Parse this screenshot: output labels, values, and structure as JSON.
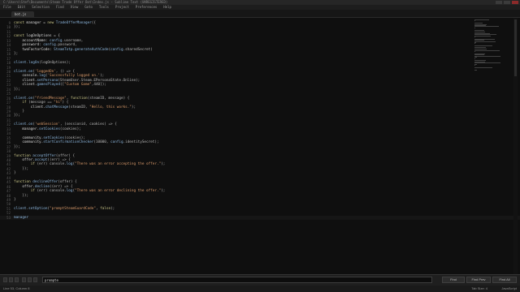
{
  "window": {
    "title": "C:\\Users\\Stef\\Documents\\Steam Trade Offer Bot\\Index.js - Sublime Text (UNREGISTERED)"
  },
  "menu": [
    "File",
    "Edit",
    "Selection",
    "Find",
    "View",
    "Goto",
    "Tools",
    "Project",
    "Preferences",
    "Help"
  ],
  "tabs": [
    {
      "label": "bot.js"
    }
  ],
  "editor": {
    "lines": [
      {
        "n": "9",
        "tokens": [
          [
            "k",
            "const "
          ],
          [
            "v",
            "manager = "
          ],
          [
            "k",
            "new "
          ],
          [
            "fn",
            "TradeOfferManager"
          ],
          [
            "p",
            "({"
          ]
        ]
      },
      {
        "n": "10",
        "tokens": [
          [
            "p",
            "});"
          ]
        ]
      },
      {
        "n": "11",
        "tokens": []
      },
      {
        "n": "12",
        "tokens": [
          [
            "k",
            "const "
          ],
          [
            "v",
            "logOnOptions = {"
          ]
        ]
      },
      {
        "n": "13",
        "tokens": [
          [
            "v",
            "    accountName: "
          ],
          [
            "fn",
            "config"
          ],
          [
            "p",
            ".username,"
          ]
        ]
      },
      {
        "n": "14",
        "tokens": [
          [
            "v",
            "    password: "
          ],
          [
            "fn",
            "config"
          ],
          [
            "p",
            ".password,"
          ]
        ]
      },
      {
        "n": "15",
        "tokens": [
          [
            "v",
            "    twoFactorCode: "
          ],
          [
            "fn",
            "SteamTotp"
          ],
          [
            "p",
            "."
          ],
          [
            "fn",
            "generateAuthCode"
          ],
          [
            "p",
            "("
          ],
          [
            "fn",
            "config"
          ],
          [
            "p",
            ".sharedSecret)"
          ]
        ]
      },
      {
        "n": "16",
        "tokens": [
          [
            "p",
            "};"
          ]
        ]
      },
      {
        "n": "17",
        "tokens": []
      },
      {
        "n": "18",
        "tokens": [
          [
            "fn",
            "client"
          ],
          [
            "p",
            "."
          ],
          [
            "fn",
            "logOn"
          ],
          [
            "p",
            "(logOnOptions);"
          ]
        ]
      },
      {
        "n": "19",
        "tokens": []
      },
      {
        "n": "20",
        "tokens": [
          [
            "fn",
            "client"
          ],
          [
            "p",
            "."
          ],
          [
            "fn",
            "on"
          ],
          [
            "p",
            "("
          ],
          [
            "s",
            "'loggedOn'"
          ],
          [
            "p",
            ", () => {"
          ]
        ]
      },
      {
        "n": "21",
        "tokens": [
          [
            "v",
            "    console."
          ],
          [
            "fn",
            "log"
          ],
          [
            "p",
            "("
          ],
          [
            "s",
            "'Successfully logged on.'"
          ],
          [
            "p",
            ");"
          ]
        ]
      },
      {
        "n": "22",
        "tokens": [
          [
            "v",
            "    client."
          ],
          [
            "fn",
            "setPersona"
          ],
          [
            "p",
            "(SteamUser.Steam.EPersonaState.Online);"
          ]
        ]
      },
      {
        "n": "23",
        "tokens": [
          [
            "v",
            "    client."
          ],
          [
            "fn",
            "gamesPlayed"
          ],
          [
            "p",
            "(["
          ],
          [
            "s",
            "\"Custom Game\""
          ],
          [
            "p",
            ",440]);"
          ]
        ]
      },
      {
        "n": "24",
        "tokens": [
          [
            "p",
            "});"
          ]
        ]
      },
      {
        "n": "25",
        "tokens": []
      },
      {
        "n": "26",
        "tokens": [
          [
            "fn",
            "client"
          ],
          [
            "p",
            "."
          ],
          [
            "fn",
            "on"
          ],
          [
            "p",
            "("
          ],
          [
            "s",
            "\"friendMessage\""
          ],
          [
            "p",
            ", "
          ],
          [
            "k",
            "function"
          ],
          [
            "p",
            "(steamID, message) {"
          ]
        ]
      },
      {
        "n": "27",
        "tokens": [
          [
            "k",
            "    if "
          ],
          [
            "p",
            "(message == "
          ],
          [
            "s",
            "\"hi\""
          ],
          [
            "p",
            ") {"
          ]
        ]
      },
      {
        "n": "28",
        "tokens": [
          [
            "v",
            "        client."
          ],
          [
            "fn",
            "chatMessage"
          ],
          [
            "p",
            "(steamID, "
          ],
          [
            "s",
            "\"Hello, this works.\""
          ],
          [
            "p",
            ");"
          ]
        ]
      },
      {
        "n": "29",
        "tokens": [
          [
            "p",
            "    }"
          ]
        ]
      },
      {
        "n": "30",
        "tokens": [
          [
            "p",
            "});"
          ]
        ]
      },
      {
        "n": "31",
        "tokens": []
      },
      {
        "n": "32",
        "tokens": [
          [
            "fn",
            "client"
          ],
          [
            "p",
            "."
          ],
          [
            "fn",
            "on"
          ],
          [
            "p",
            "("
          ],
          [
            "s",
            "'webSession'"
          ],
          [
            "p",
            ", (sessionid, cookies) => {"
          ]
        ]
      },
      {
        "n": "33",
        "tokens": [
          [
            "v",
            "    manager."
          ],
          [
            "fn",
            "setCookies"
          ],
          [
            "p",
            "(cookies);"
          ]
        ]
      },
      {
        "n": "34",
        "tokens": []
      },
      {
        "n": "35",
        "tokens": [
          [
            "v",
            "    community."
          ],
          [
            "fn",
            "setCookies"
          ],
          [
            "p",
            "(cookies);"
          ]
        ]
      },
      {
        "n": "36",
        "tokens": [
          [
            "v",
            "    community."
          ],
          [
            "fn",
            "startConfirmationChecker"
          ],
          [
            "p",
            "(10000, "
          ],
          [
            "fn",
            "config"
          ],
          [
            "p",
            ".identitySecret);"
          ]
        ]
      },
      {
        "n": "37",
        "tokens": [
          [
            "p",
            "});"
          ]
        ]
      },
      {
        "n": "38",
        "tokens": []
      },
      {
        "n": "39",
        "tokens": [
          [
            "k",
            "function "
          ],
          [
            "fn",
            "acceptOffer"
          ],
          [
            "p",
            "(offer) {"
          ]
        ]
      },
      {
        "n": "40",
        "tokens": [
          [
            "v",
            "    offer."
          ],
          [
            "fn",
            "accept"
          ],
          [
            "p",
            "((err) => {"
          ]
        ]
      },
      {
        "n": "41",
        "tokens": [
          [
            "k",
            "        if "
          ],
          [
            "p",
            "(err) console."
          ],
          [
            "fn",
            "log"
          ],
          [
            "p",
            "("
          ],
          [
            "s",
            "\"There was an error accepting the offer.\""
          ],
          [
            "p",
            ");"
          ]
        ]
      },
      {
        "n": "42",
        "tokens": [
          [
            "p",
            "    });"
          ]
        ]
      },
      {
        "n": "43",
        "tokens": [
          [
            "p",
            "}"
          ]
        ]
      },
      {
        "n": "44",
        "tokens": []
      },
      {
        "n": "45",
        "tokens": [
          [
            "k",
            "function "
          ],
          [
            "fn",
            "declineOffer"
          ],
          [
            "p",
            "(offer) {"
          ]
        ]
      },
      {
        "n": "46",
        "tokens": [
          [
            "v",
            "    offer."
          ],
          [
            "fn",
            "decline"
          ],
          [
            "p",
            "((err) => {"
          ]
        ]
      },
      {
        "n": "47",
        "tokens": [
          [
            "k",
            "        if "
          ],
          [
            "p",
            "(err) console."
          ],
          [
            "fn",
            "log"
          ],
          [
            "p",
            "("
          ],
          [
            "s",
            "\"There was an error declining the offer.\""
          ],
          [
            "p",
            ");"
          ]
        ]
      },
      {
        "n": "48",
        "tokens": [
          [
            "p",
            "    });"
          ]
        ]
      },
      {
        "n": "49",
        "tokens": [
          [
            "p",
            "}"
          ]
        ]
      },
      {
        "n": "50",
        "tokens": []
      },
      {
        "n": "51",
        "tokens": [
          [
            "fn",
            "client"
          ],
          [
            "p",
            "."
          ],
          [
            "fn",
            "setOption"
          ],
          [
            "p",
            "("
          ],
          [
            "s",
            "\"promptSteamGuardCode\""
          ],
          [
            "p",
            ", "
          ],
          [
            "k",
            "false"
          ],
          [
            "p",
            ");"
          ]
        ]
      },
      {
        "n": "52",
        "tokens": []
      },
      {
        "n": "53",
        "tokens": [
          [
            "fn",
            "manager"
          ]
        ]
      }
    ]
  },
  "find": {
    "value": "prompte",
    "find_label": "Find",
    "find_prev_label": "Find Prev",
    "find_all_label": "Find All"
  },
  "status": {
    "position": "Line 53, Column 8",
    "tab_size": "Tab Size: 4",
    "syntax": "JavaScript"
  }
}
